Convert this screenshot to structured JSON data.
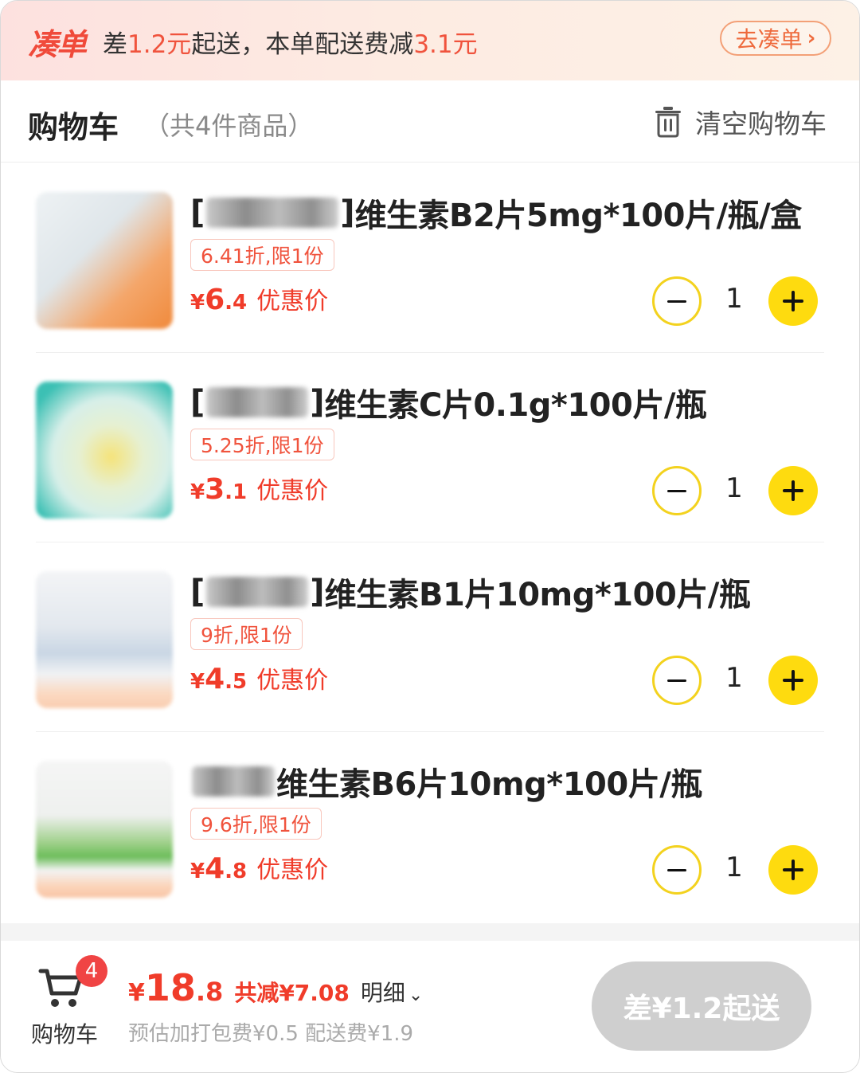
{
  "colors": {
    "accent_red": "#f03c2a",
    "stepper_yellow": "#fedb0f",
    "disabled_button": "#cfcfcf"
  },
  "promo": {
    "logo": "凑单",
    "text_prefix": "差",
    "short_amount": "1.2元",
    "text_mid": "起送，本单配送费减",
    "fee_discount": "3.1元",
    "button_label": "去凑单",
    "button_icon": "chevron-right-icon"
  },
  "cart": {
    "title": "购物车",
    "count_text": "（共4件商品）",
    "clear_label": "清空购物车",
    "clear_icon": "trash-icon"
  },
  "items": [
    {
      "open_bracket": "[",
      "close_bracket": "]",
      "name": "维生素B2片5mg*100片/瓶/盒",
      "discount": "6.41折,限1份",
      "price_symbol": "¥",
      "price_int": "6",
      "price_dec": ".4",
      "price_label": "优惠价",
      "quantity": "1"
    },
    {
      "open_bracket": "[",
      "close_bracket": "]",
      "name": "维生素C片0.1g*100片/瓶",
      "discount": "5.25折,限1份",
      "price_symbol": "¥",
      "price_int": "3",
      "price_dec": ".1",
      "price_label": "优惠价",
      "quantity": "1"
    },
    {
      "open_bracket": "[",
      "close_bracket": "]",
      "name": "维生素B1片10mg*100片/瓶",
      "discount": "9折,限1份",
      "price_symbol": "¥",
      "price_int": "4",
      "price_dec": ".5",
      "price_label": "优惠价",
      "quantity": "1"
    },
    {
      "open_bracket": "",
      "close_bracket": "",
      "name": "维生素B6片10mg*100片/瓶",
      "discount": "9.6折,限1份",
      "price_symbol": "¥",
      "price_int": "4",
      "price_dec": ".8",
      "price_label": "优惠价",
      "quantity": "1"
    }
  ],
  "footer": {
    "cart_label": "购物车",
    "badge_count": "4",
    "total_symbol": "¥",
    "total_int": "18",
    "total_dec": ".8",
    "saved_text": "共减¥7.08",
    "detail_label": "明细",
    "fees_text": "预估加打包费¥0.5 配送费¥1.9",
    "submit_label": "差¥1.2起送"
  }
}
